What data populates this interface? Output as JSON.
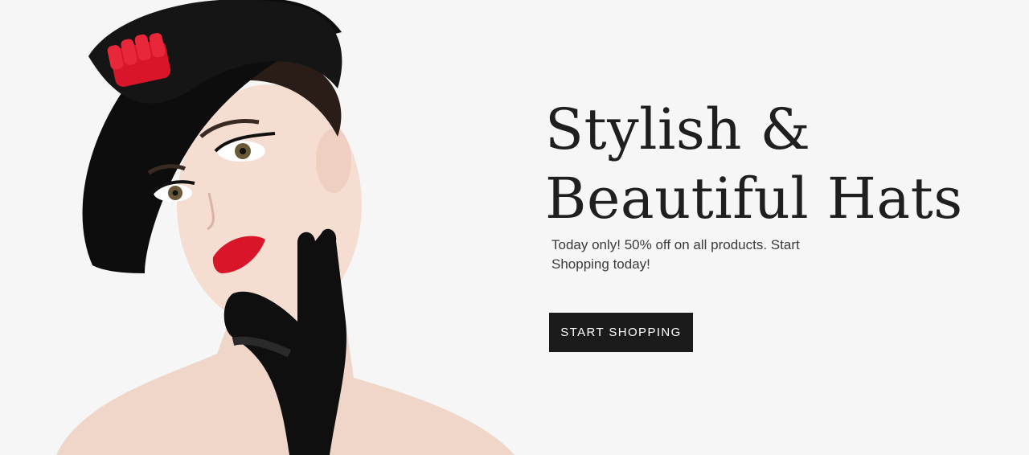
{
  "hero": {
    "headline_line1": "Stylish &",
    "headline_line2": "Beautiful Hats",
    "subtext": "Today only! 50% off on  all products. Start Shopping today!",
    "cta_label": "START SHOPPING"
  },
  "colors": {
    "background": "#f6f6f6",
    "headline": "#1f1f1f",
    "button_bg": "#1b1b1b",
    "button_text": "#ffffff",
    "accent_red": "#d9152a"
  }
}
